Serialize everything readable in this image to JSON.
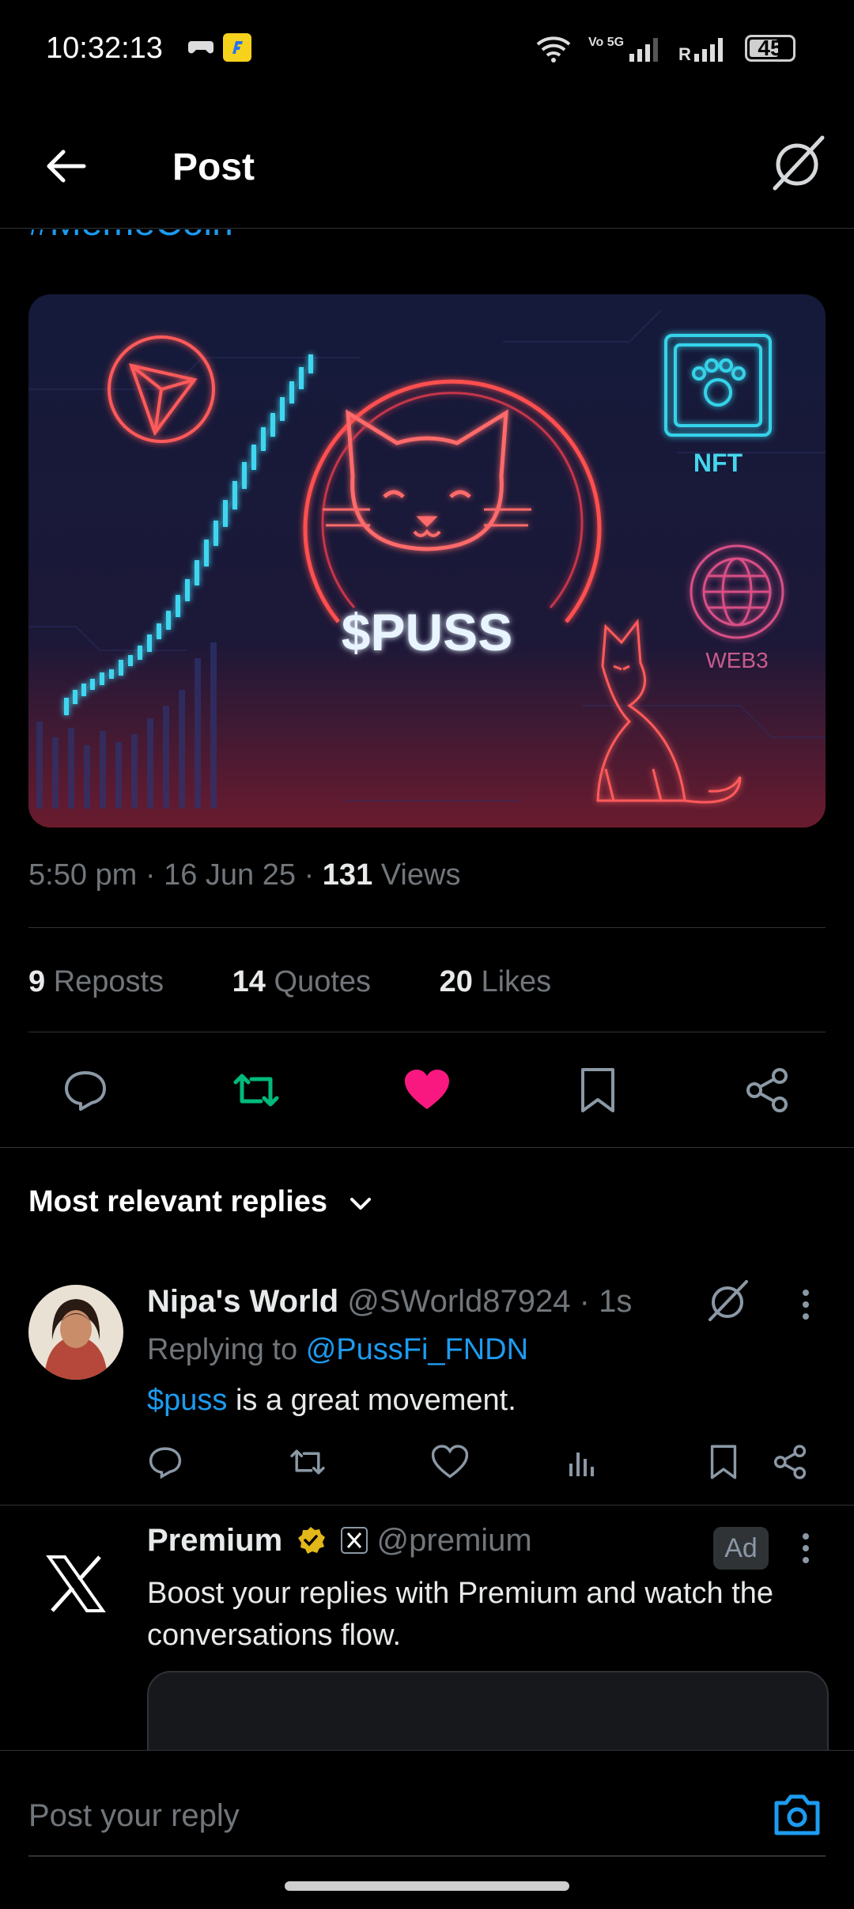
{
  "status_bar": {
    "time": "10:32:13",
    "network_label": "Vo 5G",
    "sim2_label": "R",
    "battery": "45"
  },
  "header": {
    "title": "Post"
  },
  "post": {
    "hashtag": "#MemeCoin",
    "image": {
      "token_label": "$PUSS",
      "nft_label": "NFT",
      "web3_label": "WEB3"
    },
    "time": "5:50 pm",
    "date": "16 Jun 25",
    "views_count": "131",
    "views_label": "Views",
    "reposts_count": "9",
    "reposts_label": "Reposts",
    "quotes_count": "14",
    "quotes_label": "Quotes",
    "likes_count": "20",
    "likes_label": "Likes"
  },
  "replies_filter": {
    "label": "Most relevant replies"
  },
  "reply": {
    "name": "Nipa's World",
    "handle": "@SWorld87924",
    "time": "1s",
    "replying_to_label": "Replying to",
    "replying_to_handle": "@PussFi_FNDN",
    "cashtag": "$puss",
    "text_rest": " is a great movement."
  },
  "ad": {
    "name": "Premium",
    "handle": "@premium",
    "badge": "Ad",
    "text": "Boost your replies with Premium and watch the conversations flow."
  },
  "composer": {
    "placeholder": "Post your reply"
  },
  "colors": {
    "accent": "#1d9bf0",
    "like": "#f91880",
    "repost": "#00ba7c",
    "background": "#000000"
  }
}
